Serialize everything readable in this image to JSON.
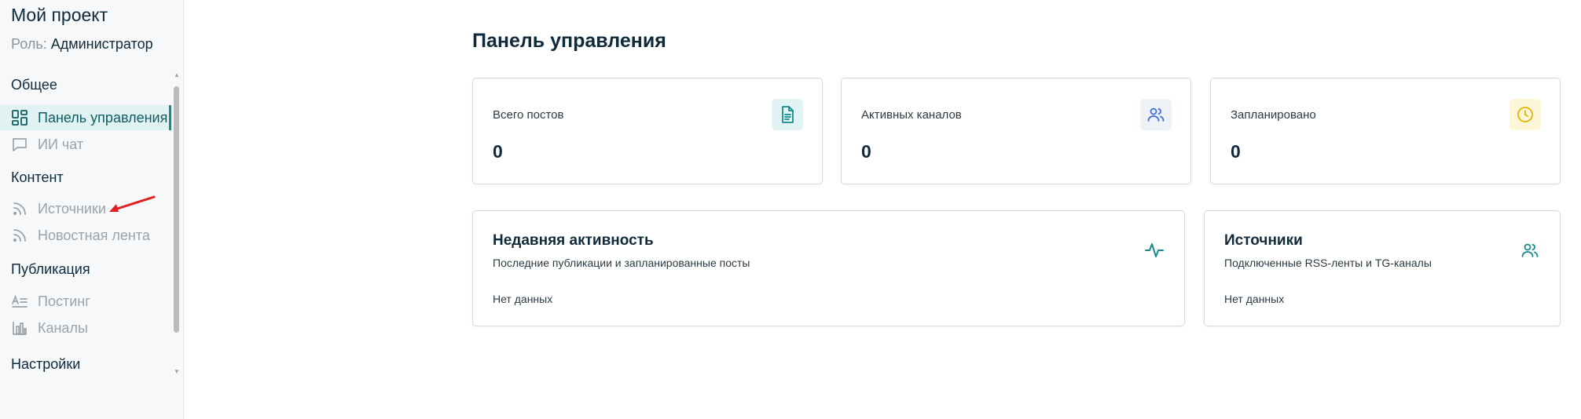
{
  "sidebar": {
    "project_title": "Мой проект",
    "role_label": "Роль:",
    "role_value": "Администратор",
    "groups": [
      {
        "label": "Общее"
      },
      {
        "label": "Контент"
      },
      {
        "label": "Публикация"
      },
      {
        "label": "Настройки"
      }
    ],
    "items": [
      {
        "label": "Панель управления",
        "icon": "dashboard-grid-icon",
        "active": true
      },
      {
        "label": "ИИ чат",
        "icon": "chat-bubble-icon"
      },
      {
        "label": "Источники",
        "icon": "rss-icon"
      },
      {
        "label": "Новостная лента",
        "icon": "rss-icon"
      },
      {
        "label": "Постинг",
        "icon": "text-format-icon"
      },
      {
        "label": "Каналы",
        "icon": "bar-chart-icon"
      }
    ]
  },
  "main": {
    "title": "Панель управления",
    "stats": [
      {
        "label": "Всего постов",
        "value": "0",
        "icon": "document-icon",
        "icon_color": "#168b8b",
        "icon_bg": "#e2f3f3"
      },
      {
        "label": "Активных каналов",
        "value": "0",
        "icon": "users-icon",
        "icon_color": "#3f6fd1",
        "icon_bg": "#eef1f6"
      },
      {
        "label": "Запланировано",
        "value": "0",
        "icon": "clock-icon",
        "icon_color": "#e0b400",
        "icon_bg": "#fdf6d8"
      }
    ],
    "activity": {
      "title": "Недавняя активность",
      "subtitle": "Последние публикации и запланированные посты",
      "empty": "Нет данных",
      "icon": "activity-pulse-icon"
    },
    "sources": {
      "title": "Источники",
      "subtitle": "Подключенные RSS-ленты и TG-каналы",
      "empty": "Нет данных",
      "icon": "users-icon"
    }
  },
  "colors": {
    "accent": "#168b8b",
    "annotation": "#e02020"
  }
}
